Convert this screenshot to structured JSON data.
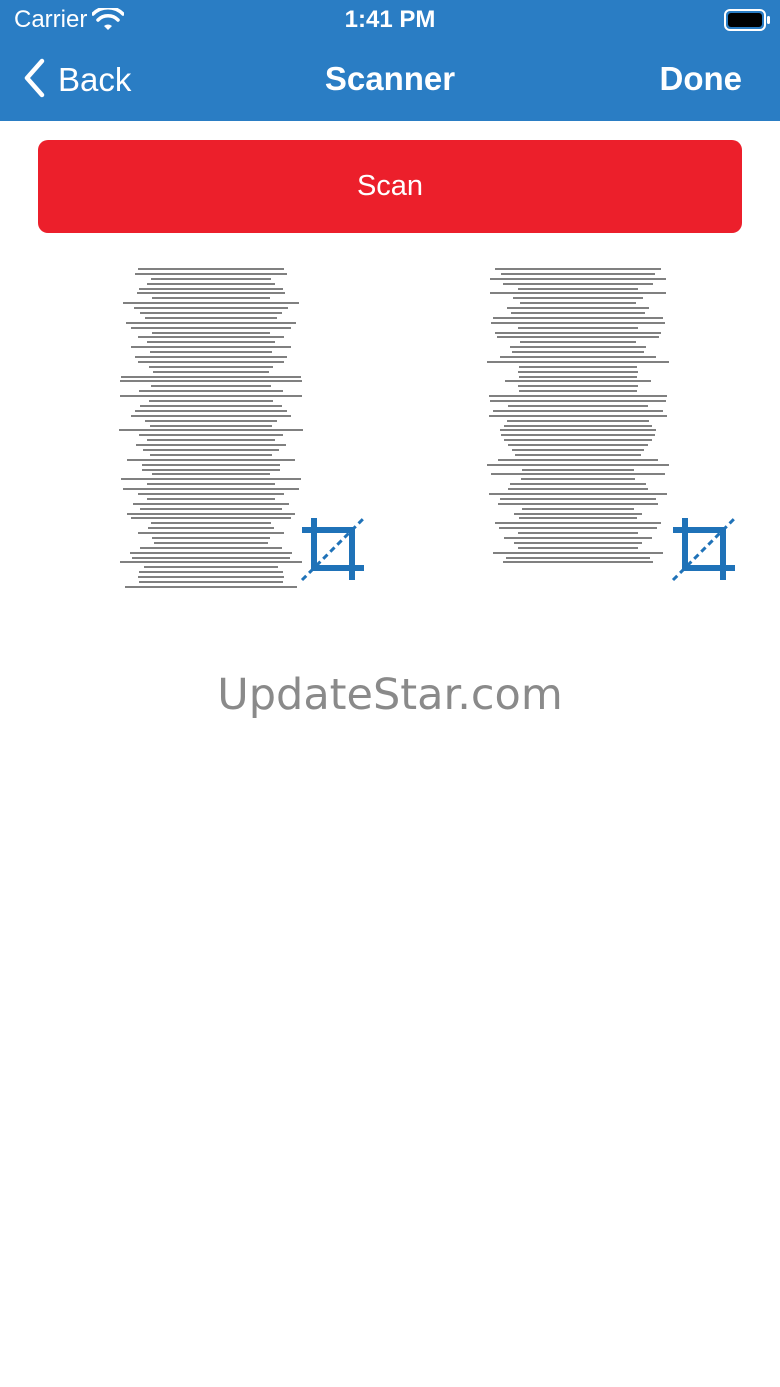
{
  "status_bar": {
    "carrier": "Carrier",
    "time": "1:41 PM",
    "icons": [
      "wifi-icon",
      "battery-icon"
    ]
  },
  "nav": {
    "back_label": "Back",
    "title": "Scanner",
    "done_label": "Done",
    "back_icon": "chevron-left-icon"
  },
  "scan_button": {
    "label": "Scan"
  },
  "scanned_pages": [
    {
      "name": "page-1",
      "icon": "crop-icon"
    },
    {
      "name": "page-2",
      "icon": "crop-icon"
    }
  ],
  "watermark": "UpdateStar.com",
  "colors": {
    "nav_bar": "#2a7dc4",
    "scan_button": "#ec1f2b",
    "crop_icon": "#1f72b8",
    "watermark": "#8a8a8a"
  }
}
